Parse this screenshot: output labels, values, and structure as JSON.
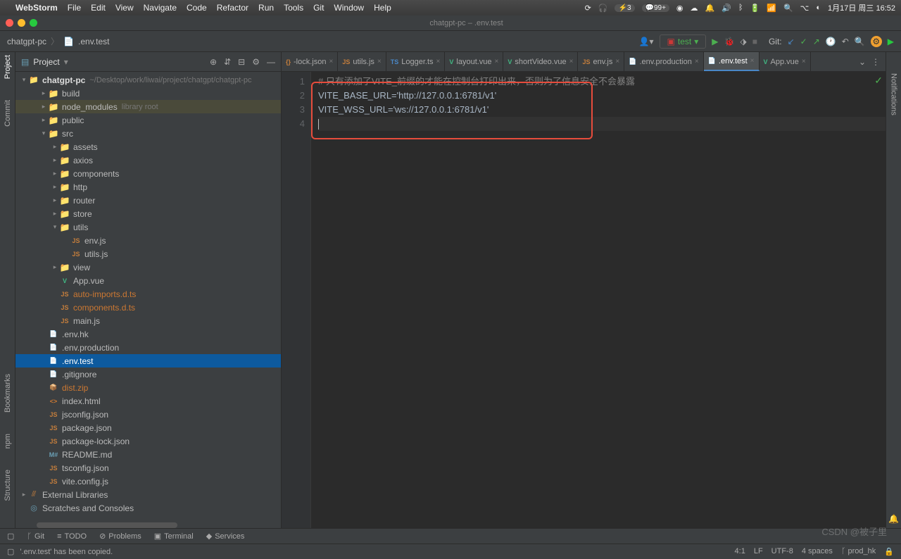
{
  "mac_menu": {
    "app": "WebStorm",
    "items": [
      "File",
      "Edit",
      "View",
      "Navigate",
      "Code",
      "Refactor",
      "Run",
      "Tools",
      "Git",
      "Window",
      "Help"
    ],
    "right": {
      "battery": "3",
      "msgs": "99+",
      "date": "1月17日 周三 16:52"
    }
  },
  "window": {
    "title": "chatgpt-pc – .env.test"
  },
  "breadcrumb": {
    "root": "chatgpt-pc",
    "file": ".env.test"
  },
  "toolbar": {
    "run_config": "test",
    "git_label": "Git:"
  },
  "left_tabs": {
    "project": "Project",
    "commit": "Commit",
    "bookmarks": "Bookmarks",
    "structure": "Structure",
    "npm": "npm"
  },
  "right_tabs": {
    "notifications": "Notifications"
  },
  "project_panel": {
    "title": "Project",
    "root": {
      "name": "chatgpt-pc",
      "path": "~/Desktop/work/liwai/project/chatgpt/chatgpt-pc"
    },
    "tree": [
      {
        "d": 1,
        "chev": ">",
        "icon": "folder",
        "label": "build"
      },
      {
        "d": 1,
        "chev": ">",
        "icon": "folder",
        "label": "node_modules",
        "suffix": "library root",
        "hl": true
      },
      {
        "d": 1,
        "chev": ">",
        "icon": "folder",
        "label": "public"
      },
      {
        "d": 1,
        "chev": "v",
        "icon": "folder",
        "label": "src"
      },
      {
        "d": 2,
        "chev": ">",
        "icon": "folder",
        "label": "assets"
      },
      {
        "d": 2,
        "chev": ">",
        "icon": "folder",
        "label": "axios"
      },
      {
        "d": 2,
        "chev": ">",
        "icon": "folder",
        "label": "components"
      },
      {
        "d": 2,
        "chev": ">",
        "icon": "folder",
        "label": "http"
      },
      {
        "d": 2,
        "chev": ">",
        "icon": "folder",
        "label": "router"
      },
      {
        "d": 2,
        "chev": ">",
        "icon": "folder",
        "label": "store"
      },
      {
        "d": 2,
        "chev": "v",
        "icon": "folder",
        "label": "utils"
      },
      {
        "d": 3,
        "chev": "",
        "icon": "js",
        "label": "env.js"
      },
      {
        "d": 3,
        "chev": "",
        "icon": "js",
        "label": "utils.js"
      },
      {
        "d": 2,
        "chev": ">",
        "icon": "folder",
        "label": "view"
      },
      {
        "d": 2,
        "chev": "",
        "icon": "vue",
        "label": "App.vue"
      },
      {
        "d": 2,
        "chev": "",
        "icon": "js",
        "label": "auto-imports.d.ts",
        "orange": true
      },
      {
        "d": 2,
        "chev": "",
        "icon": "js",
        "label": "components.d.ts",
        "orange": true
      },
      {
        "d": 2,
        "chev": "",
        "icon": "js",
        "label": "main.js"
      },
      {
        "d": 1,
        "chev": "",
        "icon": "env",
        "label": ".env.hk"
      },
      {
        "d": 1,
        "chev": "",
        "icon": "env",
        "label": ".env.production"
      },
      {
        "d": 1,
        "chev": "",
        "icon": "env",
        "label": ".env.test",
        "sel": true
      },
      {
        "d": 1,
        "chev": "",
        "icon": "txt",
        "label": ".gitignore"
      },
      {
        "d": 1,
        "chev": "",
        "icon": "zip",
        "label": "dist.zip",
        "orange": true
      },
      {
        "d": 1,
        "chev": "",
        "icon": "html",
        "label": "index.html"
      },
      {
        "d": 1,
        "chev": "",
        "icon": "js",
        "label": "jsconfig.json"
      },
      {
        "d": 1,
        "chev": "",
        "icon": "js",
        "label": "package.json"
      },
      {
        "d": 1,
        "chev": "",
        "icon": "js",
        "label": "package-lock.json"
      },
      {
        "d": 1,
        "chev": "",
        "icon": "md",
        "label": "README.md"
      },
      {
        "d": 1,
        "chev": "",
        "icon": "js",
        "label": "tsconfig.json"
      },
      {
        "d": 1,
        "chev": "",
        "icon": "js",
        "label": "vite.config.js"
      }
    ],
    "ext_lib": "External Libraries",
    "scratches": "Scratches and Consoles"
  },
  "tabs": [
    {
      "icon": "json",
      "label": "-lock.json"
    },
    {
      "icon": "js",
      "label": "utils.js"
    },
    {
      "icon": "ts",
      "label": "Logger.ts"
    },
    {
      "icon": "vue",
      "label": "layout.vue"
    },
    {
      "icon": "vue",
      "label": "shortVideo.vue"
    },
    {
      "icon": "js",
      "label": "env.js"
    },
    {
      "icon": "env",
      "label": ".env.production"
    },
    {
      "icon": "env",
      "label": ".env.test",
      "active": true
    },
    {
      "icon": "vue",
      "label": "App.vue"
    }
  ],
  "editor": {
    "lines": [
      {
        "n": 1,
        "cls": "comment",
        "text": "# 只有添加了VITE_前缀的才能在控制台打印出来，否则为了信息安全不会暴露"
      },
      {
        "n": 2,
        "cls": "text",
        "text": "VITE_BASE_URL='http://127.0.0.1:6781/v1'"
      },
      {
        "n": 3,
        "cls": "text",
        "text": "VITE_WSS_URL='ws://127.0.0.1:6781/v1'"
      },
      {
        "n": 4,
        "cls": "text",
        "text": ""
      }
    ]
  },
  "bottom_tools": {
    "git": "Git",
    "todo": "TODO",
    "problems": "Problems",
    "terminal": "Terminal",
    "services": "Services"
  },
  "status": {
    "msg": "'.env.test' has been copied.",
    "pos": "4:1",
    "le": "LF",
    "enc": "UTF-8",
    "indent": "4 spaces",
    "branch": "prod_hk"
  },
  "watermark": "CSDN @被子里"
}
